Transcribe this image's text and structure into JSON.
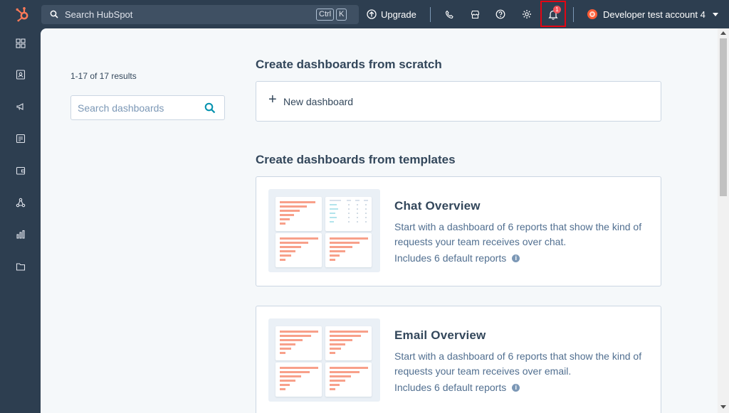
{
  "topnav": {
    "search_placeholder": "Search HubSpot",
    "shortcut_ctrl": "Ctrl",
    "shortcut_k": "K",
    "upgrade_label": "Upgrade",
    "notification_count": "1",
    "account_name": "Developer test account 4"
  },
  "sidebar": {
    "icons": [
      "grid-icon",
      "contacts-icon",
      "megaphone-icon",
      "document-icon",
      "wallet-icon",
      "network-icon",
      "reports-icon",
      "folder-icon"
    ]
  },
  "main": {
    "results_count": "1-17 of 17 results",
    "search_placeholder": "Search dashboards",
    "scratch_heading": "Create dashboards from scratch",
    "new_dashboard_label": "New dashboard",
    "templates_heading": "Create dashboards from templates",
    "templates": [
      {
        "title": "Chat Overview",
        "description": "Start with a dashboard of 6 reports that show the kind of requests your team receives over chat.",
        "includes": "Includes 6 default reports"
      },
      {
        "title": "Email Overview",
        "description": "Start with a dashboard of 6 reports that show the kind of requests your team receives over email.",
        "includes": "Includes 6 default reports"
      }
    ]
  },
  "colors": {
    "nav_bg": "#2d3e50",
    "main_bg": "#f5f8fa",
    "accent_orange": "#ff7a59",
    "highlight_red": "#e30613",
    "teal_link": "#0091ae"
  }
}
